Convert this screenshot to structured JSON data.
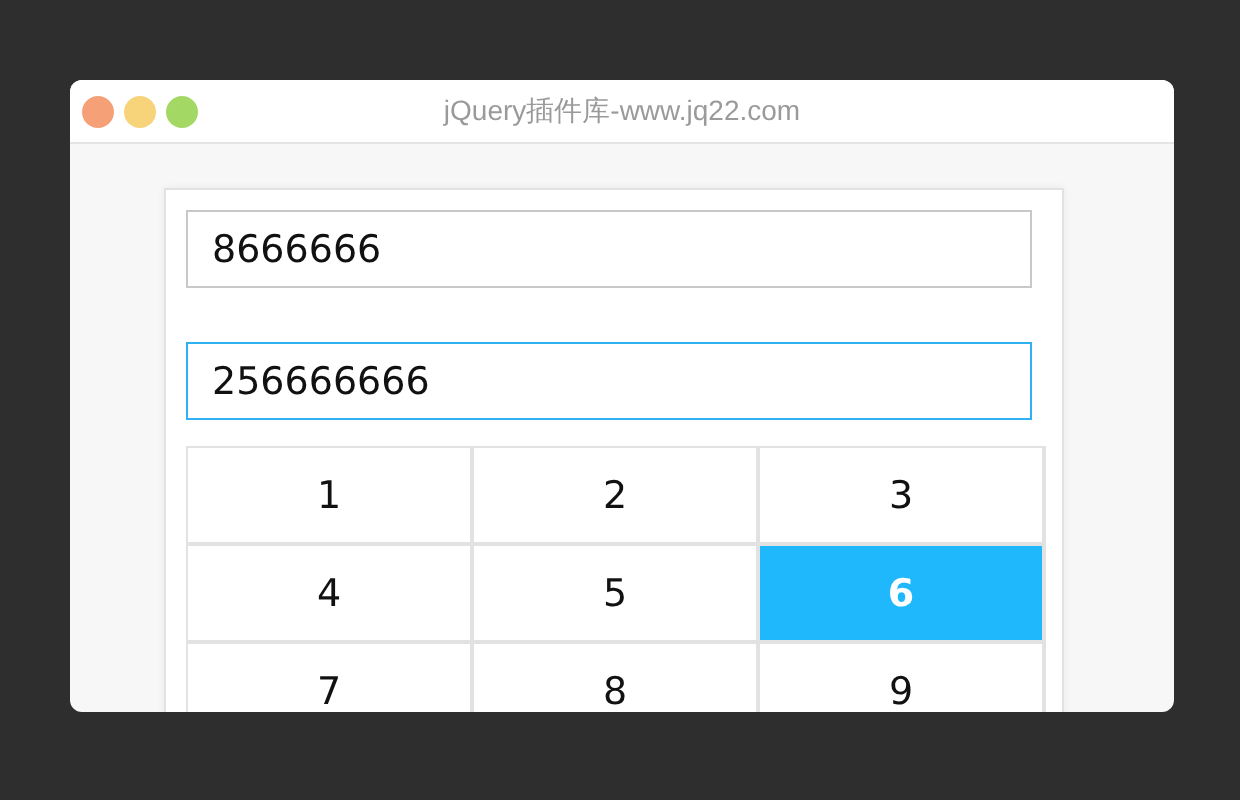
{
  "window": {
    "title": "jQuery插件库-www.jq22.com"
  },
  "fields": [
    {
      "value": "8666666",
      "focused": false
    },
    {
      "value": "256666666",
      "focused": true
    }
  ],
  "keys": [
    {
      "label": "1",
      "selected": false
    },
    {
      "label": "2",
      "selected": false
    },
    {
      "label": "3",
      "selected": false
    },
    {
      "label": "4",
      "selected": false
    },
    {
      "label": "5",
      "selected": false
    },
    {
      "label": "6",
      "selected": true
    },
    {
      "label": "7",
      "selected": false
    },
    {
      "label": "8",
      "selected": false
    },
    {
      "label": "9",
      "selected": false
    }
  ]
}
